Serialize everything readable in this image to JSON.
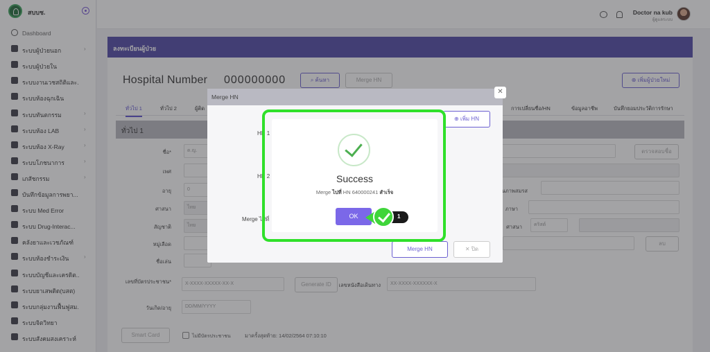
{
  "app": {
    "brand": "สบบช."
  },
  "sidebar": {
    "items": [
      {
        "label": "Dashboard",
        "icon": "clock-icon",
        "chevron": false
      },
      {
        "label": "ระบบผู้ป่วยนอก",
        "icon": "walking-person-icon",
        "chevron": true
      },
      {
        "label": "ระบบผู้ป่วยใน",
        "icon": "bed-icon",
        "chevron": false
      },
      {
        "label": "ระบบงานเวชสถิติและ...",
        "icon": "chart-icon",
        "chevron": false
      },
      {
        "label": "ระบบห้องฉุกเฉิน",
        "icon": "plus-icon",
        "chevron": false
      },
      {
        "label": "ระบบทันตกรรม",
        "icon": "tooth-icon",
        "chevron": true
      },
      {
        "label": "ระบบห้อง LAB",
        "icon": "lab-icon",
        "chevron": true
      },
      {
        "label": "ระบบห้อง X-Ray",
        "icon": "heart-icon",
        "chevron": true
      },
      {
        "label": "ระบบโภชนาการ",
        "icon": "food-icon",
        "chevron": true
      },
      {
        "label": "เภสัชกรรม",
        "icon": "pill-icon",
        "chevron": true
      },
      {
        "label": "บันทึกข้อมูลการพยา...",
        "icon": "hand-icon",
        "chevron": false
      },
      {
        "label": "ระบบ Med Error",
        "icon": "hand-icon",
        "chevron": false
      },
      {
        "label": "ระบบ Drug-Interac...",
        "icon": "hand-icon",
        "chevron": false
      },
      {
        "label": "คลังยาและเวชภัณฑ์",
        "icon": "box-icon",
        "chevron": false
      },
      {
        "label": "ระบบห้องชำระเงิน",
        "icon": "people-icon",
        "chevron": true
      },
      {
        "label": "ระบบบัญชีและเครดิต...",
        "icon": "user-icon",
        "chevron": false
      },
      {
        "label": "ระบบยาเสพติด(บสต)",
        "icon": "hand-icon",
        "chevron": false
      },
      {
        "label": "ระบบกลุ่มงานฟื้นฟูสม...",
        "icon": "hand-icon",
        "chevron": false
      },
      {
        "label": "ระบบจิตวิทยา",
        "icon": "chat-icon",
        "chevron": false
      },
      {
        "label": "ระบบสังคมสงเคราะห์",
        "icon": "people-icon",
        "chevron": false
      }
    ]
  },
  "topbar": {
    "user_name": "Doctor na kub",
    "user_role": "ผู้ดูแลระบบ"
  },
  "page": {
    "header": "ลงทะเบียนผู้ป่วย",
    "hn_label": "Hospital Number",
    "hn_value": "000000000",
    "search_button": "⌕ ค้นหา",
    "merge_button": "Merge HN",
    "add_patient_button": "⊕ เพิ่มผู้ป่วยใหม่",
    "tabs": [
      "ทั่วไป 1",
      "ทั่วไป 2",
      "ผู้ติด",
      "การเปลี่ยนชื่อ/HN",
      "ข้อมูลอาชีพ",
      "บันทึกยอมประวัติการรักษา"
    ],
    "section_title": "ทั่วไป 1",
    "fields": {
      "name_label": "ชื่อ*",
      "name_prefix": "ด.ญ.",
      "gender_label": "เพศ",
      "age_label": "อายุ",
      "age_value": "0",
      "religion_label": "ศาสนา",
      "religion_value": "ไทย",
      "nationality_label": "สัญชาติ",
      "nationality_value": "ไทย",
      "blood_label": "หมู่เลือด",
      "nickname_label": "ชื่อเล่น",
      "idcard_label": "เลขที่บัตรประชาชน*",
      "idcard_placeholder": "X-XXXX-XXXXX-XX-X",
      "generate_id_button": "Generate ID",
      "passport_label": "เลขหนังสือเดินทาง",
      "passport_placeholder": "XX-XXXX-XXXXXX-X",
      "dob_label": "วันเกิด/อายุ",
      "dob_placeholder": "DD/MM/YYYY",
      "marital_label": "สถานภาพสมรส",
      "language_label": "ภาษา",
      "religion2_label": "ศาสนา",
      "religion2_value": "คริสต์",
      "name_check_button": "ตรวจสอบชื่อ",
      "smartcard_button": "Smart Card",
      "no_card_label": "ไม่มีบัตรประชาชน",
      "last_visit": "มาครั้งสุดท้าย: 14/02/2564 07:10:10",
      "delete_button": "ลบ"
    }
  },
  "merge_modal": {
    "title": "Merge HN",
    "hn1_label": "HN 1",
    "hn2_label": "HN 2",
    "add_hn_button": "⊕ เพิ่ม HN",
    "merge_to_label": "Merge ไปที่",
    "merge_button": "Merge HN",
    "cancel_button": "✕ ปิด"
  },
  "success_dialog": {
    "title": "Success",
    "msg_prefix": "Merge",
    "msg_bold1": "ไปที่",
    "msg_middle": "HN 640000241",
    "msg_bold2": "สำเร็จ",
    "ok_button": "OK"
  },
  "step_marker": {
    "number": "1",
    "color": "#3fd53a"
  },
  "colors": {
    "primary": "#6b5fd0",
    "header": "#4f47a6",
    "highlight": "#2fe02a"
  }
}
